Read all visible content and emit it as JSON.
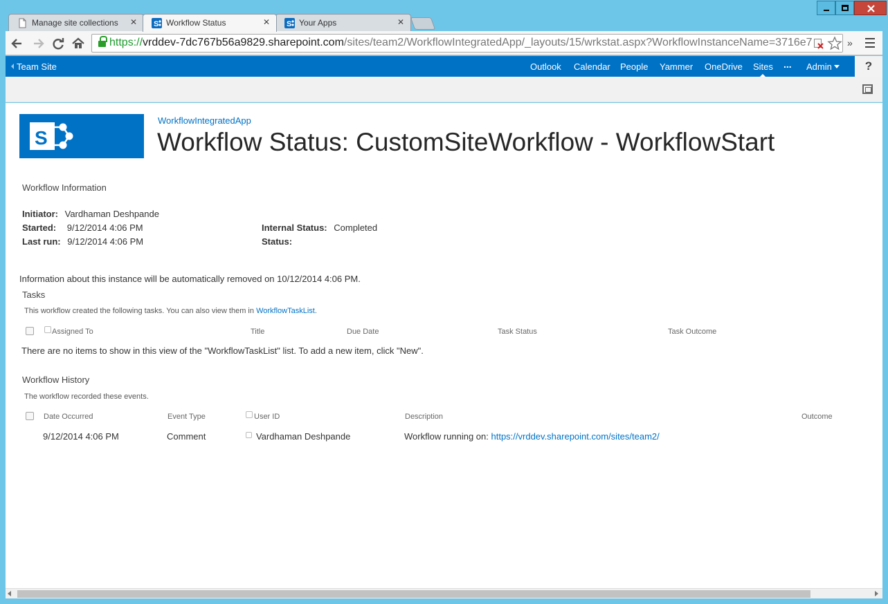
{
  "browser": {
    "tabs": [
      {
        "title": "Manage site collections"
      },
      {
        "title": "Workflow Status"
      },
      {
        "title": "Your Apps"
      }
    ],
    "url": {
      "scheme": "https://",
      "host": "vrddev-7dc767b56a9829.sharepoint.com",
      "path": "/sites/team2/WorkflowIntegratedApp/_layouts/15/wrkstat.aspx?WorkflowInstanceName=3716e7"
    },
    "icons": {
      "back": "back-arrow-icon",
      "forward": "forward-arrow-icon",
      "reload": "reload-icon",
      "home": "home-icon",
      "menu": "hamburger-menu-icon",
      "star": "bookmark-star-icon",
      "extensions": "chevron-double-right-icon"
    }
  },
  "suitebar": {
    "site_link": "Team Site",
    "nav": [
      "Outlook",
      "Calendar",
      "People",
      "Yammer",
      "OneDrive",
      "Sites"
    ],
    "more": "...",
    "user": "Admin",
    "help": "?"
  },
  "page": {
    "breadcrumb": "WorkflowIntegratedApp",
    "title": "Workflow Status: CustomSiteWorkflow - WorkflowStart",
    "workflow_info": {
      "heading": "Workflow Information",
      "initiator_label": "Initiator:",
      "initiator_value": "Vardhaman Deshpande",
      "started_label": "Started:",
      "started_value": "9/12/2014 4:06 PM",
      "lastrun_label": "Last run:",
      "lastrun_value": "9/12/2014 4:06 PM",
      "internal_status_label": "Internal Status:",
      "internal_status_value": "Completed",
      "status_label": "Status:"
    },
    "removal_notice": "Information about this instance will be automatically removed on 10/12/2014 4:06 PM.",
    "tasks": {
      "heading": "Tasks",
      "desc_prefix": "This workflow created the following tasks. You can also view them in ",
      "desc_link": "WorkflowTaskList",
      "desc_suffix": ".",
      "columns": [
        "Assigned To",
        "Title",
        "Due Date",
        "Task Status",
        "Task Outcome"
      ],
      "empty_message": "There are no items to show in this view of the \"WorkflowTaskList\" list. To add a new item, click \"New\"."
    },
    "history": {
      "heading": "Workflow History",
      "desc": "The workflow recorded these events.",
      "columns": [
        "Date Occurred",
        "Event Type",
        "User ID",
        "Description",
        "Outcome"
      ],
      "rows": [
        {
          "date": "9/12/2014 4:06 PM",
          "event_type": "Comment",
          "user": "Vardhaman Deshpande",
          "description_prefix": "Workflow running on: ",
          "description_link": "https://vrddev.sharepoint.com/sites/team2/",
          "outcome": ""
        }
      ]
    }
  },
  "colors": {
    "suitebar": "#0072c6",
    "link": "#0072c6",
    "window_frame": "#6dc6e8",
    "close_button": "#c7463b"
  }
}
